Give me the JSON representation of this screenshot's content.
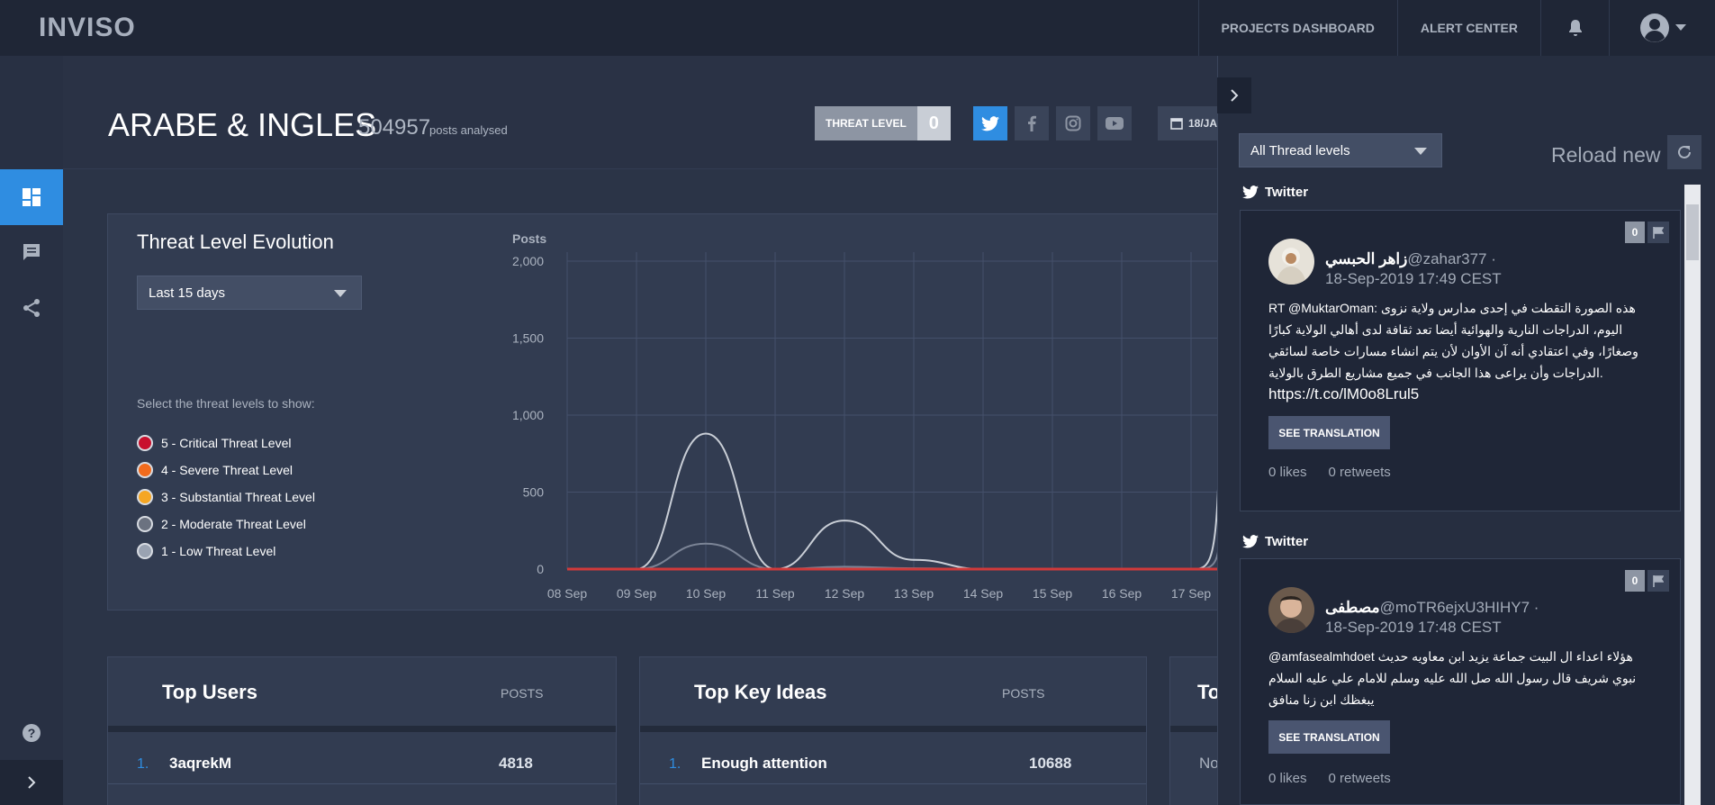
{
  "app": {
    "logo": "INVISO"
  },
  "topnav": {
    "projects_dashboard": "PROJECTS DASHBOARD",
    "alert_center": "ALERT CENTER"
  },
  "header": {
    "title": "ARABE & INGLES",
    "posts_count": "504957",
    "posts_label": "posts analysed",
    "threat_level_label": "THREAT LEVEL",
    "threat_level_value": "0",
    "date_partial": "18/JA"
  },
  "threat_evolution": {
    "title": "Threat Level Evolution",
    "range_select": "Last 15 days",
    "hint": "Select the threat levels to show:",
    "levels": [
      {
        "label": "5 - Critical Threat Level",
        "color": "#c8102e"
      },
      {
        "label": "4 - Severe Threat Level",
        "color": "#f26b1d"
      },
      {
        "label": "3 - Substantial Threat Level",
        "color": "#f5a623"
      },
      {
        "label": "2 - Moderate Threat Level",
        "color": "#6b7280"
      },
      {
        "label": "1 - Low Threat Level",
        "color": "#9aa3b2"
      }
    ]
  },
  "chart_data": {
    "type": "line",
    "ylabel": "Posts",
    "ylim": [
      0,
      2000
    ],
    "yticks": [
      "2,000",
      "1,500",
      "1,000",
      "500",
      "0"
    ],
    "categories": [
      "08 Sep",
      "09 Sep",
      "10 Sep",
      "11 Sep",
      "12 Sep",
      "13 Sep",
      "14 Sep",
      "15 Sep",
      "16 Sep",
      "17 Sep"
    ],
    "series": [
      {
        "color": "#c9ced6",
        "values": [
          0,
          0,
          880,
          0,
          315,
          60,
          0,
          0,
          0,
          0
        ]
      },
      {
        "color": "#7b8496",
        "values": [
          0,
          0,
          165,
          0,
          15,
          5,
          0,
          0,
          0,
          0
        ]
      },
      {
        "color": "#d23a3a",
        "values": [
          0,
          0,
          0,
          0,
          0,
          0,
          0,
          0,
          0,
          0
        ]
      }
    ]
  },
  "top_users": {
    "title": "Top Users",
    "posts_label": "POSTS",
    "rows": [
      {
        "rank": "1.",
        "name": "3aqrekM",
        "value": "4818"
      }
    ]
  },
  "top_ideas": {
    "title": "Top Key Ideas",
    "posts_label": "POSTS",
    "rows": [
      {
        "rank": "1.",
        "name": "Enough attention",
        "value": "10688"
      }
    ]
  },
  "third_card": {
    "title_partial": "To",
    "row_partial": "No"
  },
  "panel": {
    "filter_select": "All Thread levels",
    "reload_label": "Reload new",
    "tweets": [
      {
        "source": "Twitter",
        "flag_count": "0",
        "author_name": "زاهر الحبسي",
        "handle": "@zahar377 ·",
        "date": "18-Sep-2019 17:49 CEST",
        "text": "RT @MuktarOman: هذه الصورة التقطت في إحدى مدارس ولاية نزوى اليوم، الدراجات النارية والهوائية أيضا تعد ثقافة لدى أهالي الولاية كبارًا وصغارًا، وفي اعتقادي أنه آن الأوان لأن يتم انشاء مسارات خاصة لسائقي الدراجات وأن يراعى هذا الجانب في جميع مشاريع الطرق بالولاية.",
        "link": "https://t.co/lM0o8Lrul5",
        "translate": "SEE TRANSLATION",
        "likes": "0 likes",
        "retweets": "0 retweets"
      },
      {
        "source": "Twitter",
        "flag_count": "0",
        "author_name": "مصطفى",
        "handle": "@moTR6ejxU3HIHY7 ·",
        "date": "18-Sep-2019 17:48 CEST",
        "text": "@amfasealmhdoet هؤلاء اعداء ال البيت جماعة يزيد ابن معاويه حديث نبوي شريف قال رسول الله صل الله عليه وسلم للامام علي عليه السلام يبغظك ابن زنا منافق",
        "link": "",
        "translate": "SEE TRANSLATION",
        "likes": "0 likes",
        "retweets": "0 retweets"
      }
    ]
  }
}
